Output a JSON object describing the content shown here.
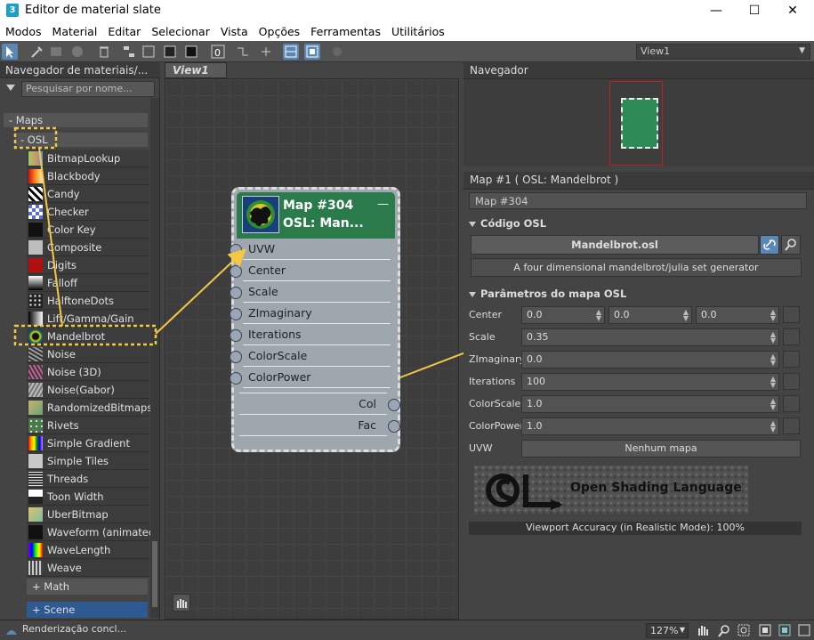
{
  "window": {
    "title": "Editor de material slate",
    "app_icon": "3"
  },
  "menu": [
    "Modos",
    "Material",
    "Editar",
    "Selecionar",
    "Vista",
    "Opções",
    "Ferramentas",
    "Utilitários"
  ],
  "toolbar": {
    "view_select": "View1"
  },
  "left_panel": {
    "header": "Navegador de materiais/...",
    "search_placeholder": "Pesquisar por nome...",
    "group_maps": "- Maps",
    "group_osl": "- OSL",
    "items": [
      {
        "label": "BitmapLookup",
        "icon": "bitmap-lookup-swatch"
      },
      {
        "label": "Blackbody",
        "icon": "blackbody-swatch"
      },
      {
        "label": "Candy",
        "icon": "candy-swatch"
      },
      {
        "label": "Checker",
        "icon": "checker-swatch"
      },
      {
        "label": "Color Key",
        "icon": "color-key-swatch"
      },
      {
        "label": "Composite",
        "icon": "composite-swatch"
      },
      {
        "label": "Digits",
        "icon": "digits-swatch"
      },
      {
        "label": "Falloff",
        "icon": "falloff-swatch"
      },
      {
        "label": "HalftoneDots",
        "icon": "halftone-swatch"
      },
      {
        "label": "Lift/Gamma/Gain",
        "icon": "lift-gamma-gain-swatch"
      },
      {
        "label": "Mandelbrot",
        "icon": "mandelbrot-swatch"
      },
      {
        "label": "Noise",
        "icon": "noise-swatch"
      },
      {
        "label": "Noise (3D)",
        "icon": "noise-3d-swatch"
      },
      {
        "label": "Noise(Gabor)",
        "icon": "noise-gabor-swatch"
      },
      {
        "label": "RandomizedBitmaps",
        "icon": "randomized-bitmaps-swatch"
      },
      {
        "label": "Rivets",
        "icon": "rivets-swatch"
      },
      {
        "label": "Simple Gradient",
        "icon": "simple-gradient-swatch"
      },
      {
        "label": "Simple Tiles",
        "icon": "simple-tiles-swatch"
      },
      {
        "label": "Threads",
        "icon": "threads-swatch"
      },
      {
        "label": "Toon Width",
        "icon": "toon-width-swatch"
      },
      {
        "label": "UberBitmap",
        "icon": "uber-bitmap-swatch"
      },
      {
        "label": "Waveform (animated)",
        "icon": "waveform-swatch"
      },
      {
        "label": "WaveLength",
        "icon": "wavelength-swatch"
      },
      {
        "label": "Weave",
        "icon": "weave-swatch"
      }
    ],
    "group_math": "+ Math",
    "group_scene": "+ Scene"
  },
  "view": {
    "tab": "View1",
    "node": {
      "title": "Map #304",
      "subtitle": "OSL:  Man...",
      "minimize": "—",
      "inputs": [
        "UVW",
        "Center",
        "Scale",
        "ZImaginary",
        "Iterations",
        "ColorScale",
        "ColorPower"
      ],
      "outputs": [
        "Col",
        "Fac"
      ]
    }
  },
  "navigator": {
    "header": "Navegador"
  },
  "map_panel": {
    "header": "Map #1  ( OSL: Mandelbrot )",
    "name_field": "Map #304",
    "osl_code_rollout": "Código OSL",
    "osl_file": "Mandelbrot.osl",
    "osl_description": "A four dimensional mandelbrot/julia set generator",
    "params_rollout": "Parâmetros do mapa OSL",
    "params": {
      "center_label": "Center",
      "center_x": "0.0",
      "center_y": "0.0",
      "center_z": "0.0",
      "scale_label": "Scale",
      "scale_value": "0.35",
      "zimag_label": "ZImaginary",
      "zimag_value": "0.0",
      "iter_label": "Iterations",
      "iter_value": "100",
      "colorscale_label": "ColorScale",
      "colorscale_value": "1.0",
      "colorpower_label": "ColorPower",
      "colorpower_value": "1.0",
      "uvw_label": "UVW",
      "uvw_button": "Nenhum mapa"
    },
    "logo_text": "Open Shading Language",
    "viewport_accuracy": "Viewport Accuracy (in Realistic Mode): 100%"
  },
  "status": {
    "text": "Renderização concl...",
    "zoom": "127%"
  },
  "colors": {
    "node_header": "#2a7a4b",
    "highlight_dash": "#f5c842",
    "arrow": "#f5c842"
  }
}
